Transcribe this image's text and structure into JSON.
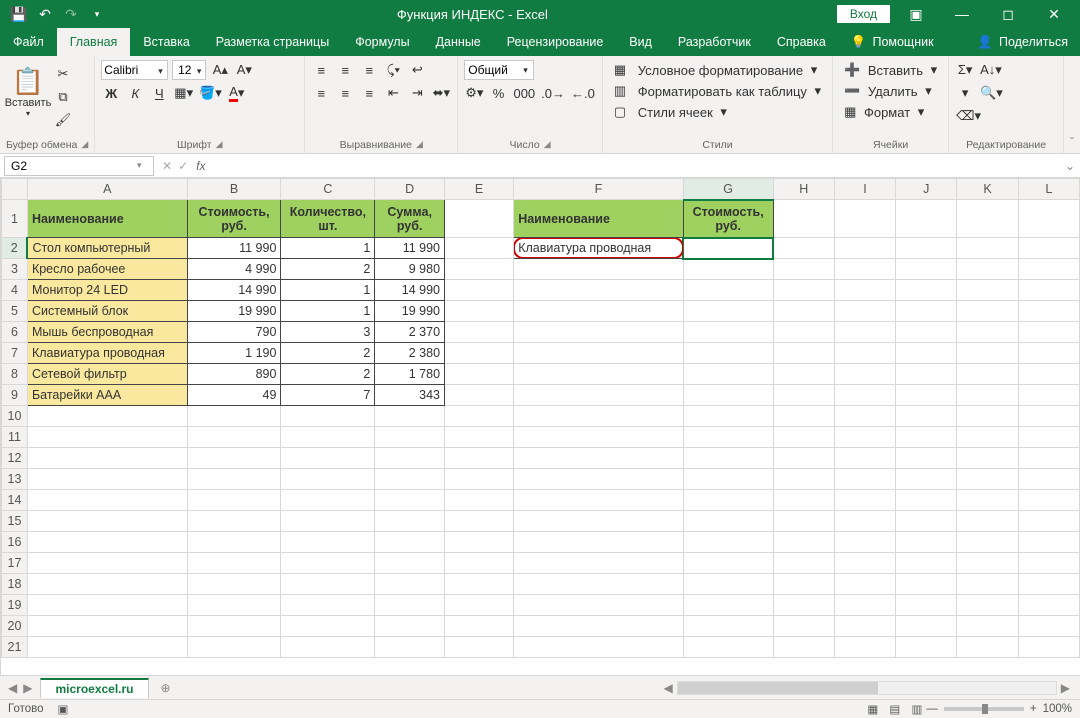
{
  "titlebar": {
    "title": "Функция ИНДЕКС  -  Excel",
    "login": "Вход"
  },
  "tabs": {
    "file": "Файл",
    "home": "Главная",
    "insert": "Вставка",
    "pagelayout": "Разметка страницы",
    "formulas": "Формулы",
    "data": "Данные",
    "review": "Рецензирование",
    "view": "Вид",
    "developer": "Разработчик",
    "help": "Справка",
    "tellme": "Помощник",
    "share": "Поделиться"
  },
  "ribbon": {
    "clipboard": {
      "paste": "Вставить",
      "label": "Буфер обмена"
    },
    "font": {
      "name": "Calibri",
      "size": "12",
      "bold": "Ж",
      "italic": "К",
      "underline": "Ч",
      "label": "Шрифт"
    },
    "align": {
      "label": "Выравнивание"
    },
    "number": {
      "format": "Общий",
      "label": "Число"
    },
    "styles": {
      "cond": "Условное форматирование",
      "table": "Форматировать как таблицу",
      "cell": "Стили ячеек",
      "label": "Стили"
    },
    "cells": {
      "insert": "Вставить",
      "delete": "Удалить",
      "format": "Формат",
      "label": "Ячейки"
    },
    "editing": {
      "label": "Редактирование"
    }
  },
  "namebox": "G2",
  "formula": "",
  "columns": [
    "A",
    "B",
    "C",
    "D",
    "E",
    "F",
    "G",
    "H",
    "I",
    "J",
    "K",
    "L"
  ],
  "rownums": [
    1,
    2,
    3,
    4,
    5,
    6,
    7,
    8,
    9,
    10,
    11,
    12,
    13,
    14,
    15,
    16,
    17,
    18,
    19,
    20,
    21
  ],
  "headers": {
    "A": "Наименование",
    "B": "Стоимость, руб.",
    "C": "Количество, шт.",
    "D": "Сумма, руб.",
    "F": "Наименование",
    "G": "Стоимость, руб."
  },
  "rows": [
    {
      "A": "Стол компьютерный",
      "B": "11 990",
      "C": "1",
      "D": "11 990"
    },
    {
      "A": "Кресло рабочее",
      "B": "4 990",
      "C": "2",
      "D": "9 980"
    },
    {
      "A": "Монитор 24 LED",
      "B": "14 990",
      "C": "1",
      "D": "14 990"
    },
    {
      "A": "Системный блок",
      "B": "19 990",
      "C": "1",
      "D": "19 990"
    },
    {
      "A": "Мышь беспроводная",
      "B": "790",
      "C": "3",
      "D": "2 370"
    },
    {
      "A": "Клавиатура проводная",
      "B": "1 190",
      "C": "2",
      "D": "2 380"
    },
    {
      "A": "Сетевой фильтр",
      "B": "890",
      "C": "2",
      "D": "1 780"
    },
    {
      "A": "Батарейки AAA",
      "B": "49",
      "C": "7",
      "D": "343"
    }
  ],
  "lookup": {
    "F2": "Клавиатура проводная"
  },
  "sheet": {
    "name": "microexcel.ru"
  },
  "status": {
    "ready": "Готово",
    "zoom": "100%"
  }
}
